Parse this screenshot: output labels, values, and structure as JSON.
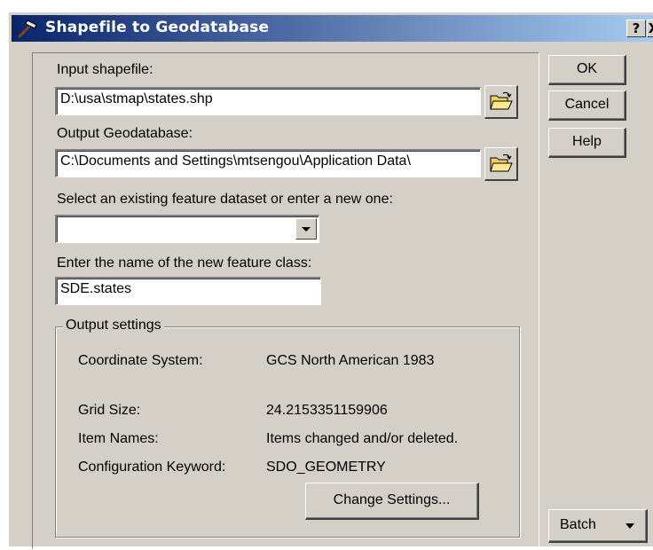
{
  "window": {
    "title": "Shapefile to Geodatabase",
    "help_button": "?",
    "close_button": "X"
  },
  "form": {
    "input_shapefile_label": "Input shapefile:",
    "input_shapefile_value": "D:\\usa\\stmap\\states.shp",
    "output_gdb_label": "Output Geodatabase:",
    "output_gdb_value": "C:\\Documents and Settings\\mtsengou\\Application Data\\",
    "dataset_label": "Select an existing feature dataset or enter a new one:",
    "dataset_value": "",
    "feature_class_label": "Enter the name of the new feature class:",
    "feature_class_value": "SDE.states"
  },
  "output_settings": {
    "legend": "Output settings",
    "rows": [
      {
        "key": "Coordinate System:",
        "value": "GCS North American 1983"
      },
      {
        "key": "Grid Size:",
        "value": "24.2153351159906"
      },
      {
        "key": "Item Names:",
        "value": "Items changed and/or deleted."
      },
      {
        "key": "Configuration Keyword:",
        "value": "SDO_GEOMETRY"
      }
    ],
    "change_settings_label": "Change Settings..."
  },
  "buttons": {
    "ok": "OK",
    "cancel": "Cancel",
    "help": "Help",
    "batch": "Batch"
  }
}
